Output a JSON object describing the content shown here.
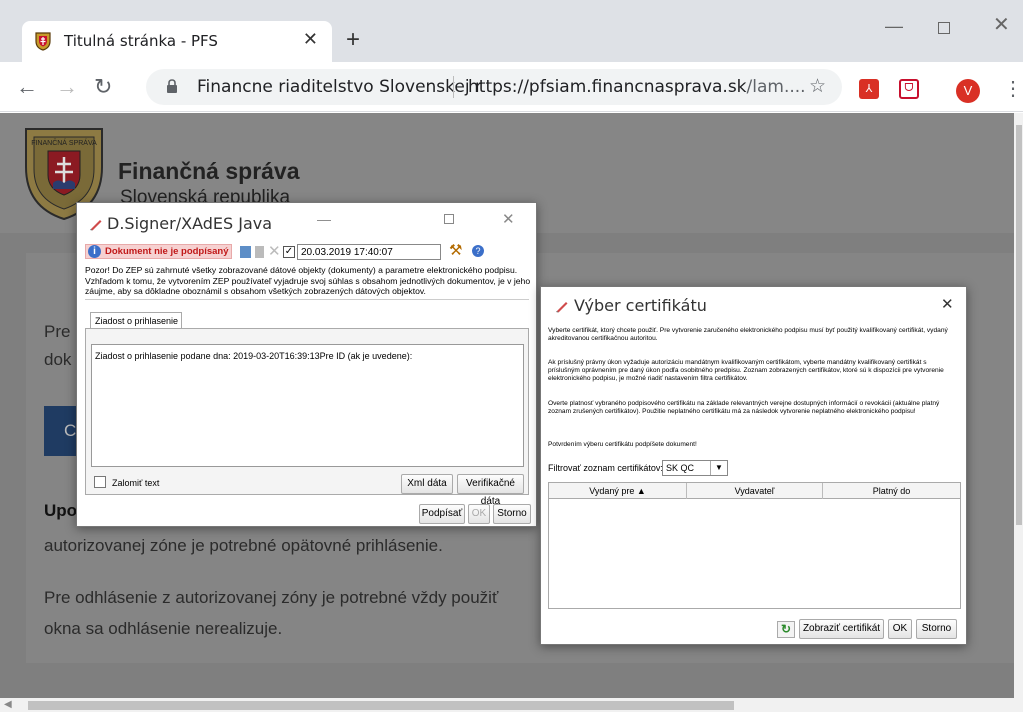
{
  "browser": {
    "tab_title": "Titulná stránka - PFS",
    "site_name": "Financne riaditelstvo Slovenskej r",
    "url_host": "https://pfsiam.financnasprava.sk",
    "url_path": "/lam....",
    "avatar_letter": "V"
  },
  "page": {
    "brand_title": "Finančná správa",
    "brand_subtitle": "Slovenská republika",
    "para1_line1": "Pre",
    "para1_line2": "dok",
    "button_letter": "C",
    "note_bold": "Upo",
    "line3": "autorizovanej zóne je potrebné opätovné prihlásenie.",
    "line4": "Pre odhlásenie z autorizovanej zóny je potrebné vždy použiť",
    "line5": "okna sa odhlásenie nerealizuje."
  },
  "signer": {
    "title": "D.Signer/XAdES Java",
    "status": "Dokument nie je podpísaný",
    "timestamp": "20.03.2019 17:40:07",
    "warning": "Pozor! Do ZEP sú zahrnuté všetky zobrazované dátové objekty (dokumenty) a parametre elektronického podpisu. Vzhľadom k tomu, že vytvorením ZEP používateľ vyjadruje svoj súhlas s obsahom jednotlivých dokumentov, je v jeho záujme, aby sa dôkladne oboznámil s obsahom všetkých zobrazených dátových objektov.",
    "tab": "Ziadost o prihlasenie",
    "content": "Ziadost o prihlasenie podane dna: 2019-03-20T16:39:13Pre ID (ak je uvedene):",
    "wrap_label": "Zalomiť text",
    "xml_btn": "Xml dáta",
    "verif_btn": "Verifikačné dáta",
    "sign_btn": "Podpísať",
    "ok_btn": "OK",
    "cancel_btn": "Storno"
  },
  "cert": {
    "title": "Výber certifikátu",
    "p1": "Vyberte certifikát, ktorý chcete použiť. Pre vytvorenie zaručeného elektronického podpisu musí byť použitý kvalifikovaný certifikát, vydaný akreditovanou certifikačnou autoritou.",
    "p2": "Ak príslušný právny úkon vyžaduje autorizáciu mandátnym kvalifikovaným certifikátom, vyberte mandátny kvalifikovaný certifikát s príslušným oprávnením pre daný úkon podľa osobitného predpisu. Zoznam zobrazených certifikátov, ktoré sú k dispozícii pre vytvorenie elektronického podpisu, je možné riadiť nastavením filtra certifikátov.",
    "p3": "Overte platnosť vybraného podpisového certifikátu na základe relevantných verejne dostupných informácií o revokácii (aktuálne platný zoznam zrušených certifikátov). Použitie neplatného certifikátu má za následok vytvorenie neplatného elektronického podpisu!",
    "p4": "Potvrdením výberu certifikátu podpíšete dokument!",
    "filter_label": "Filtrovať zoznam certifikátov:",
    "filter_value": "SK QC",
    "col1": "Vydaný pre ▲",
    "col2": "Vydavateľ",
    "col3": "Platný do",
    "show_btn": "Zobraziť certifikát",
    "ok_btn": "OK",
    "cancel_btn": "Storno"
  },
  "colors": {
    "accent_red": "#d93025",
    "page_dim": "#7f7f7f",
    "button_navy": "#1f3b62"
  }
}
